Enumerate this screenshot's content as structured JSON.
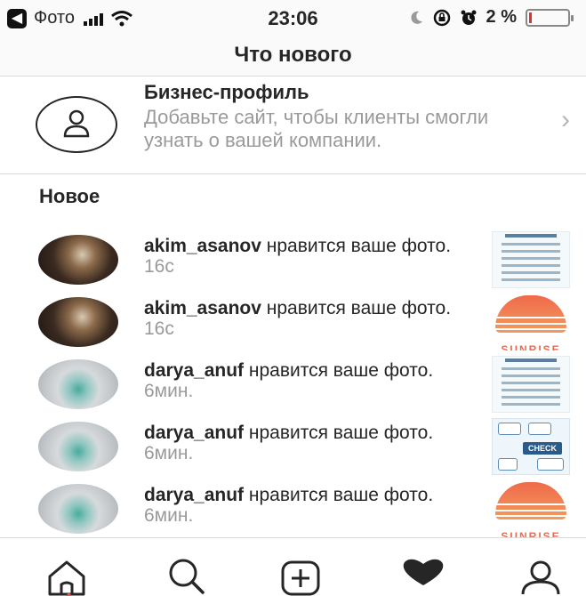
{
  "status_bar": {
    "back_label": "Фото",
    "time": "23:06",
    "battery_percent": "2 %",
    "battery_level": 0.02,
    "battery_color": "#e0322a"
  },
  "header": {
    "title": "Что нового"
  },
  "business_profile": {
    "title": "Бизнес-профиль",
    "subtitle": "Добавьте сайт, чтобы клиенты смогли узнать о вашей компании.",
    "icon": "user-outline-icon"
  },
  "section_title": "Новое",
  "notifications": [
    {
      "username": "akim_asanov",
      "action": " нравится ваше фото.",
      "time": " 16с",
      "avatar": "dark",
      "thumbnail": "chart-sheet"
    },
    {
      "username": "akim_asanov",
      "action": " нравится ваше фото.",
      "time": " 16с",
      "avatar": "dark",
      "thumbnail": "sunrise"
    },
    {
      "username": "darya_anuf",
      "action": " нравится ваше фото.",
      "time": " 6мин.",
      "avatar": "light",
      "thumbnail": "chart-sheet"
    },
    {
      "username": "darya_anuf",
      "action": " нравится ваше фото.",
      "time": " 6мин.",
      "avatar": "light",
      "thumbnail": "check-diagram"
    },
    {
      "username": "darya_anuf",
      "action": " нравится ваше фото.",
      "time": " 6мин.",
      "avatar": "light",
      "thumbnail": "sunrise"
    }
  ],
  "thumbnail_text": {
    "check_label": "CHECK",
    "sunrise_word": "SUNRISE"
  },
  "tab_bar": {
    "items": [
      "home-icon",
      "search-icon",
      "add-post-icon",
      "heart-icon",
      "profile-icon"
    ],
    "active": "heart-icon",
    "notification_dot_color": "#ed4956"
  }
}
